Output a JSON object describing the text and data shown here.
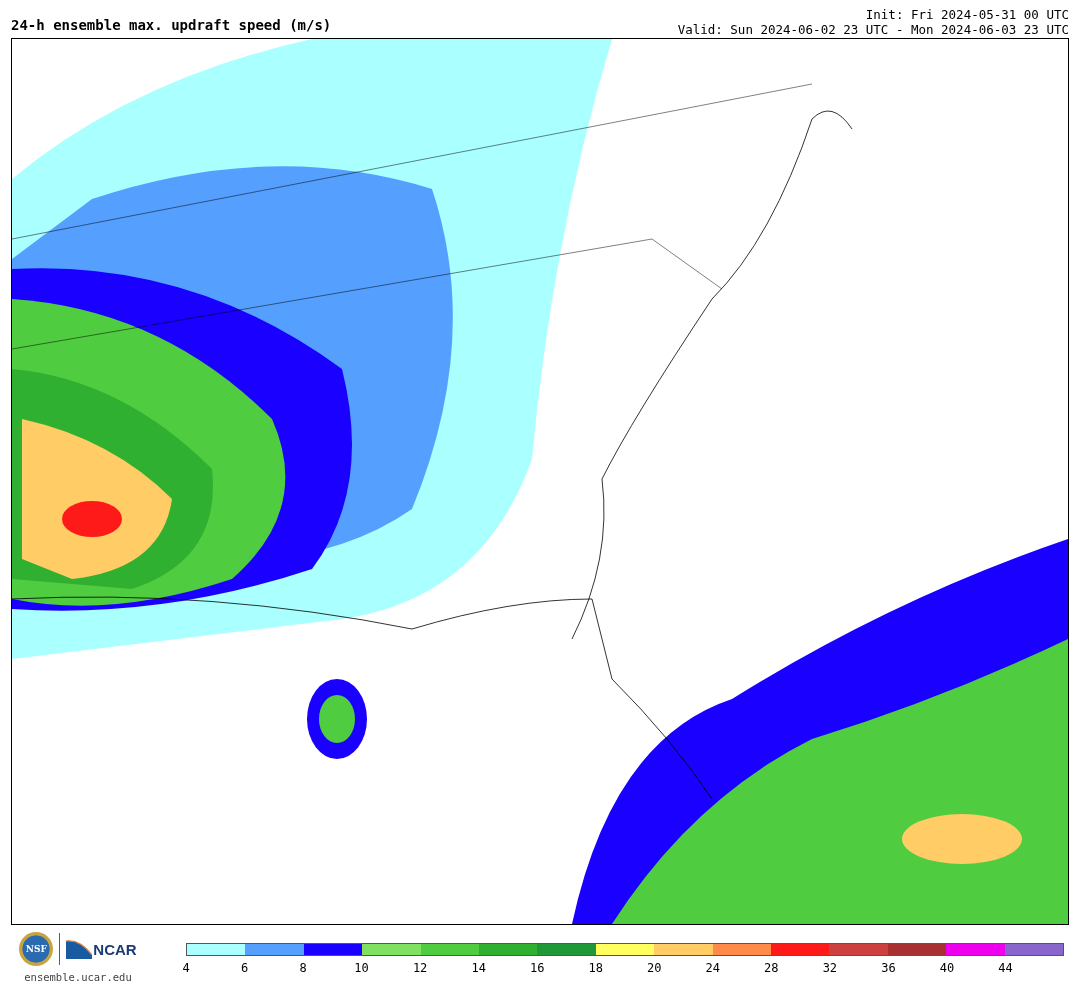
{
  "header": {
    "title": "24-h ensemble max. updraft speed (m/s)",
    "init": "Init: Fri 2024-05-31 00 UTC",
    "valid": "Valid: Sun 2024-06-02 23 UTC - Mon 2024-06-03 23 UTC"
  },
  "footer": {
    "logos": [
      {
        "kind": "seal",
        "text": "NSF"
      },
      {
        "kind": "wordmark",
        "text": "NCAR"
      }
    ],
    "site": "ensemble.ucar.edu"
  },
  "colorbar": {
    "segments": [
      {
        "color": "#aaffff"
      },
      {
        "color": "#55a0ff"
      },
      {
        "color": "#1a00ff"
      },
      {
        "color": "#80e060"
      },
      {
        "color": "#50cc40"
      },
      {
        "color": "#30b030"
      },
      {
        "color": "#209838"
      },
      {
        "color": "#ffff60"
      },
      {
        "color": "#ffcc66"
      },
      {
        "color": "#ff8a4a"
      },
      {
        "color": "#ff1a1a"
      },
      {
        "color": "#cc4040"
      },
      {
        "color": "#a83030"
      },
      {
        "color": "#ee00ee"
      },
      {
        "color": "#8866cc"
      }
    ],
    "ticks": [
      "4",
      "6",
      "8",
      "10",
      "12",
      "14",
      "16",
      "18",
      "20",
      "24",
      "28",
      "32",
      "36",
      "40",
      "44"
    ]
  }
}
